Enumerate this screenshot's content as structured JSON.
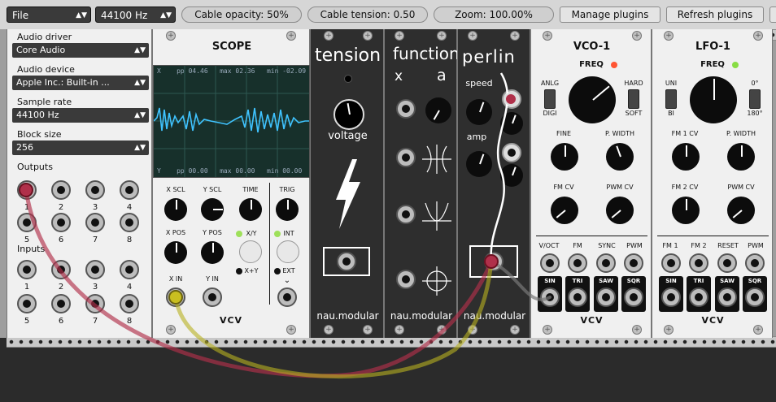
{
  "toolbar": {
    "file_label": "File",
    "sample_rate": "44100 Hz",
    "cable_opacity": "Cable opacity: 50%",
    "cable_tension": "Cable tension: 0.50",
    "zoom": "Zoom: 100.00%",
    "manage_plugins": "Manage plugins",
    "refresh_plugins": "Refresh plugins"
  },
  "audio": {
    "driver_label": "Audio driver",
    "driver_value": "Core Audio",
    "device_label": "Audio device",
    "device_value": "Apple Inc.: Built-in ...",
    "rate_label": "Sample rate",
    "rate_value": "44100 Hz",
    "block_label": "Block size",
    "block_value": "256",
    "outputs_label": "Outputs",
    "inputs_label": "Inputs",
    "jack_numbers": [
      "1",
      "2",
      "3",
      "4",
      "5",
      "6",
      "7",
      "8"
    ]
  },
  "scope": {
    "title": "SCOPE",
    "top_readout": {
      "ch": "X",
      "pp_label": "pp",
      "pp": "04.46",
      "max_label": "max",
      "max": "02.36",
      "min_label": "min",
      "min": "-02.09"
    },
    "bottom_readout": {
      "ch": "Y",
      "pp_label": "pp",
      "pp": "00.00",
      "max_label": "max",
      "max": "00.00",
      "min_label": "min",
      "min": "00.00"
    },
    "labels": {
      "xscl": "X SCL",
      "yscl": "Y SCL",
      "time": "TIME",
      "trig": "TRIG",
      "xpos": "X POS",
      "ypos": "Y POS",
      "xy": "X/Y",
      "xandy": "X+Y",
      "int": "INT",
      "ext": "EXT",
      "xin": "X IN",
      "yin": "Y IN"
    },
    "brand": "VCV"
  },
  "tension": {
    "title": "tension",
    "sub": "voltage",
    "brand": "nau.modular"
  },
  "function": {
    "title": "function",
    "x": "x",
    "a": "a",
    "brand": "nau.modular"
  },
  "perlin": {
    "title": "perlin",
    "speed": "speed",
    "amp": "amp",
    "brand": "nau.modular"
  },
  "vco": {
    "title": "VCO-1",
    "freq": "FREQ",
    "anlg": "ANLG",
    "digi": "DIGI",
    "hard": "HARD",
    "soft": "SOFT",
    "fine": "FINE",
    "pwidth": "P. WIDTH",
    "fmcv": "FM CV",
    "pwmcv": "PWM CV",
    "voct": "V/OCT",
    "fm": "FM",
    "sync": "SYNC",
    "pwm": "PWM",
    "sin": "SIN",
    "tri": "TRI",
    "saw": "SAW",
    "sqr": "SQR",
    "brand": "VCV",
    "led_color": "#ff5533"
  },
  "lfo": {
    "title": "LFO-1",
    "freq": "FREQ",
    "uni": "UNI",
    "bi": "BI",
    "deg0": "0°",
    "deg180": "180°",
    "fm1cv": "FM 1 CV",
    "pwidth": "P. WIDTH",
    "fm2cv": "FM 2 CV",
    "pwmcv": "PWM CV",
    "fm1": "FM 1",
    "fm2": "FM 2",
    "reset": "RESET",
    "pwm": "PWM",
    "sin": "SIN",
    "tri": "TRI",
    "saw": "SAW",
    "sqr": "SQR",
    "brand": "VCV",
    "led_color": "#88dd44"
  },
  "colors": {
    "cable_red": "#b0304a",
    "cable_yellow": "#b8b020",
    "scope_trace": "#3fc3ff"
  }
}
